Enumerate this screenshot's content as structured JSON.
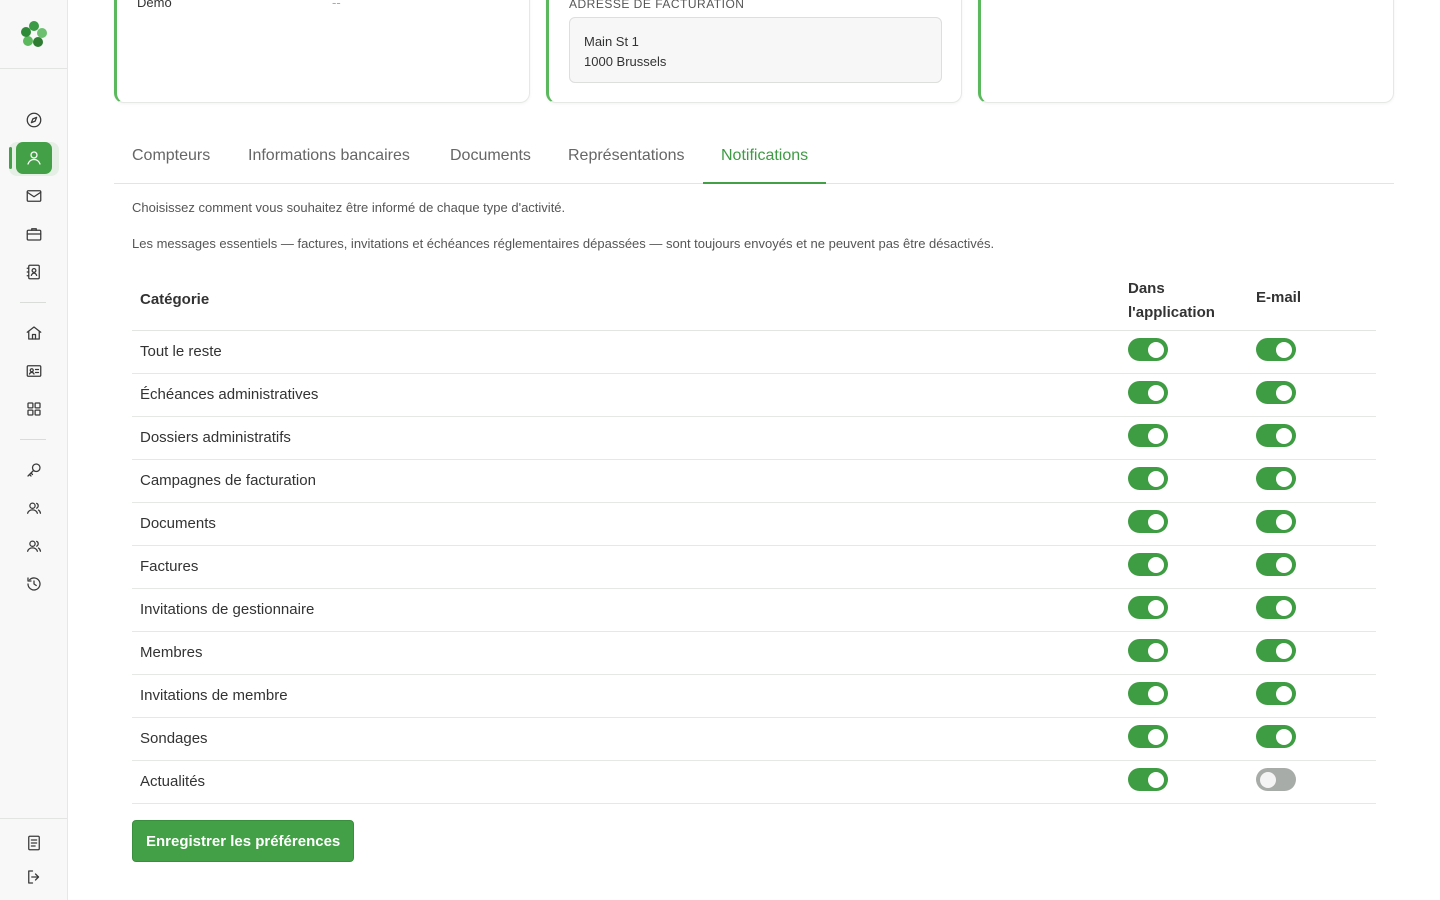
{
  "colors": {
    "accent": "#43a047",
    "toggle_on": "#3e9c42",
    "toggle_off": "#a8aca8"
  },
  "sidebar": {
    "items": [
      {
        "icon": "compass-icon"
      },
      {
        "icon": "user-icon",
        "active": true
      },
      {
        "icon": "mail-icon"
      },
      {
        "icon": "briefcase-icon"
      },
      {
        "icon": "contact-book-icon"
      },
      {
        "icon": "home-icon"
      },
      {
        "icon": "id-card-icon"
      },
      {
        "icon": "grid-icon"
      },
      {
        "icon": "key-icon"
      },
      {
        "icon": "users-icon"
      },
      {
        "icon": "team-icon"
      },
      {
        "icon": "history-icon"
      }
    ],
    "bottom": [
      {
        "icon": "document-icon"
      },
      {
        "icon": "logout-icon"
      }
    ]
  },
  "cards": {
    "card1": {
      "label": "Demo",
      "value": "--"
    },
    "card2": {
      "title": "Adresse de facturation",
      "address_line1": "Main St 1",
      "address_line2": "1000 Brussels"
    }
  },
  "tabs": [
    {
      "label": "Compteurs"
    },
    {
      "label": "Informations bancaires"
    },
    {
      "label": "Documents"
    },
    {
      "label": "Représentations"
    },
    {
      "label": "Notifications",
      "active": true
    }
  ],
  "notifications": {
    "intro1": "Choisissez comment vous souhaitez être informé de chaque type d'activité.",
    "intro2": "Les messages essentiels — factures, invitations et échéances réglementaires dépassées — sont toujours envoyés et ne peuvent pas être désactivés.",
    "headers": {
      "category": "Catégorie",
      "in_app": "Dans l'application",
      "email": "E-mail"
    },
    "rows": [
      {
        "label": "Tout le reste",
        "in_app": true,
        "email": true
      },
      {
        "label": "Échéances administratives",
        "in_app": true,
        "email": true
      },
      {
        "label": "Dossiers administratifs",
        "in_app": true,
        "email": true
      },
      {
        "label": "Campagnes de facturation",
        "in_app": true,
        "email": true
      },
      {
        "label": "Documents",
        "in_app": true,
        "email": true
      },
      {
        "label": "Factures",
        "in_app": true,
        "email": true
      },
      {
        "label": "Invitations de gestionnaire",
        "in_app": true,
        "email": true
      },
      {
        "label": "Membres",
        "in_app": true,
        "email": true
      },
      {
        "label": "Invitations de membre",
        "in_app": true,
        "email": true
      },
      {
        "label": "Sondages",
        "in_app": true,
        "email": true
      },
      {
        "label": "Actualités",
        "in_app": true,
        "email": false
      }
    ],
    "save_label": "Enregistrer les préférences"
  }
}
